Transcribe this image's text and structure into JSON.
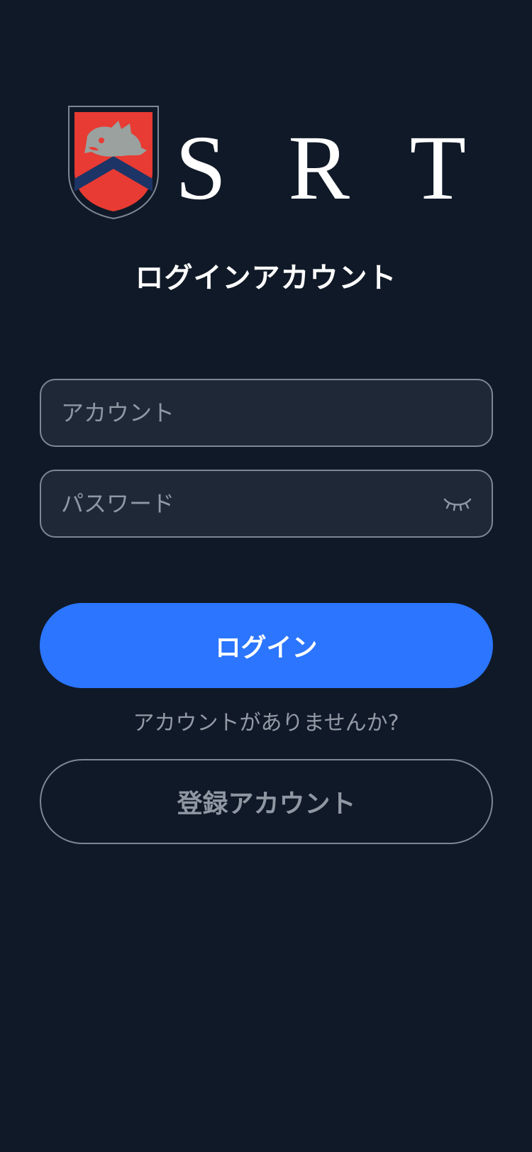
{
  "brand": {
    "wordmark": "S R T",
    "colors": {
      "crest_red": "#e83b33",
      "crest_navy": "#1d3466",
      "crest_emblem": "#9aa19e",
      "wordmark": "#ffffff"
    }
  },
  "login": {
    "title": "ログインアカウント",
    "account_placeholder": "アカウント",
    "password_placeholder": "パスワード",
    "password_toggle_icon": "eye-closed-icon",
    "submit_label": "ログイン",
    "no_account_text": "アカウントがありませんか?",
    "register_label": "登録アカウント"
  },
  "colors": {
    "background": "#101927",
    "field_background": "#1e2837",
    "field_border": "#7e8793",
    "primary": "#2b75ff",
    "muted_text": "#939aa6"
  }
}
